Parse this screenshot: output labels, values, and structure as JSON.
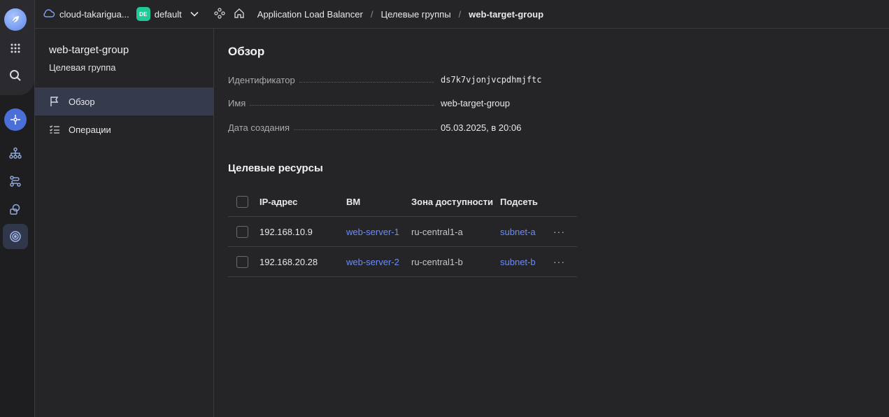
{
  "colors": {
    "accent": "#4a6fd8",
    "link": "#6c8cf5",
    "folder_badge": "#20c997",
    "background": "#252528"
  },
  "header": {
    "cloud_name": "cloud-takarigua...",
    "folder_badge": "DE",
    "folder_name": "default",
    "breadcrumbs": [
      "Application Load Balancer",
      "Целевые группы",
      "web-target-group"
    ],
    "separator": "/"
  },
  "rail": {
    "icons": [
      "logo-icon",
      "apps-grid-icon",
      "search-icon",
      "alb-icon",
      "hierarchy-icon",
      "routes-icon",
      "shapes-icon",
      "target-icon"
    ]
  },
  "sidebar": {
    "title": "web-target-group",
    "subtitle": "Целевая группа",
    "items": [
      {
        "label": "Обзор",
        "icon": "flag-icon",
        "active": true
      },
      {
        "label": "Операции",
        "icon": "checklist-icon",
        "active": false
      }
    ]
  },
  "overview": {
    "title": "Обзор",
    "props": [
      {
        "label": "Идентификатор",
        "value": "ds7k7vjonjvcpdhmjftc"
      },
      {
        "label": "Имя",
        "value": "web-target-group"
      },
      {
        "label": "Дата создания",
        "value": "05.03.2025, в 20:06"
      }
    ]
  },
  "targets": {
    "title": "Целевые ресурсы",
    "columns": [
      "IP-адрес",
      "ВМ",
      "Зона доступности",
      "Подсеть"
    ],
    "rows": [
      {
        "ip": "192.168.10.9",
        "vm": "web-server-1",
        "zone": "ru-central1-a",
        "subnet": "subnet-a",
        "more": "···"
      },
      {
        "ip": "192.168.20.28",
        "vm": "web-server-2",
        "zone": "ru-central1-b",
        "subnet": "subnet-b",
        "more": "···"
      }
    ]
  }
}
